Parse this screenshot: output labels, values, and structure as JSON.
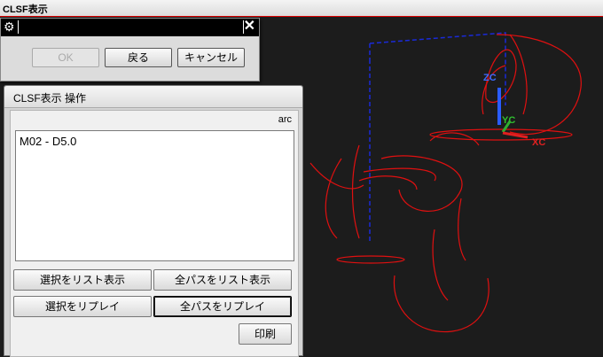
{
  "window": {
    "title": "CLSF表示"
  },
  "mini_dialog": {
    "ok_label": "OK",
    "back_label": "戻る",
    "cancel_label": "キャンセル"
  },
  "panel": {
    "title": "CLSF表示 操作",
    "mode_label": "arc",
    "list_items": [
      "M02 - D5.0"
    ],
    "buttons": {
      "list_selected": "選択をリスト表示",
      "list_all": "全パスをリスト表示",
      "replay_selected": "選択をリプレイ",
      "replay_all": "全パスをリプレイ",
      "print": "印刷"
    }
  },
  "viewport": {
    "axis_labels": {
      "z": "ZC",
      "y": "YC",
      "x": "XC"
    },
    "colors": {
      "toolpath": "#e01010",
      "rapid": "#1a2ad8",
      "axis_z": "#2a5cff",
      "axis_y": "#2fae2f",
      "axis_x": "#e02020",
      "background": "#1c1c1c"
    }
  }
}
